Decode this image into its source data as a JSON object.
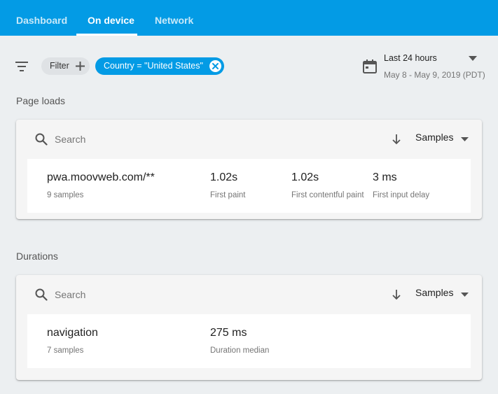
{
  "tabs": [
    {
      "label": "Dashboard",
      "active": false
    },
    {
      "label": "On device",
      "active": true
    },
    {
      "label": "Network",
      "active": false
    }
  ],
  "filters": {
    "filter_chip_label": "Filter",
    "country_chip_label": "Country = \"United States\""
  },
  "date_range": {
    "label": "Last 24 hours",
    "dates": "May 8 - May 9, 2019 (PDT)"
  },
  "page_loads": {
    "title": "Page loads",
    "search_placeholder": "Search",
    "sort_label": "Samples",
    "rows": [
      {
        "name": "pwa.moovweb.com/**",
        "samples": "9 samples",
        "metrics": [
          {
            "value": "1.02s",
            "label": "First paint"
          },
          {
            "value": "1.02s",
            "label": "First contentful paint"
          },
          {
            "value": "3 ms",
            "label": "First input delay"
          }
        ]
      }
    ]
  },
  "durations": {
    "title": "Durations",
    "search_placeholder": "Search",
    "sort_label": "Samples",
    "rows": [
      {
        "name": "navigation",
        "samples": "7 samples",
        "metrics": [
          {
            "value": "275 ms",
            "label": "Duration median"
          }
        ]
      }
    ]
  },
  "colors": {
    "accent": "#039be5",
    "background": "#eceff1",
    "card": "#f5f5f5"
  },
  "icons": [
    "filter-list-icon",
    "add-icon",
    "cancel-icon",
    "calendar-icon",
    "dropdown-caret-icon",
    "search-icon",
    "arrow-downward-icon"
  ]
}
